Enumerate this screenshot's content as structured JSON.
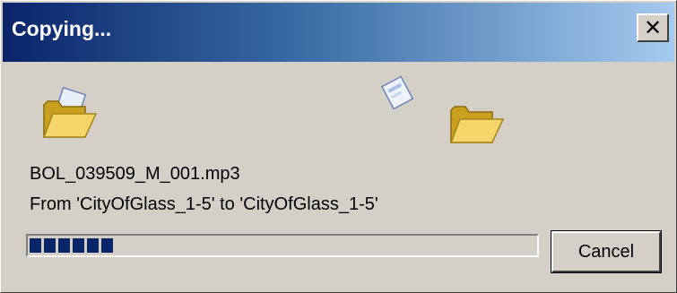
{
  "window": {
    "title": "Copying...",
    "close_symbol": "✕"
  },
  "icons": {
    "source_folder": "open-folder-icon",
    "flying_document": "flying-document-icon",
    "destination_folder": "open-folder-icon"
  },
  "operation": {
    "file_name": "BOL_039509_M_001.mp3",
    "from_to": "From 'CityOfGlass_1-5' to 'CityOfGlass_1-5'"
  },
  "progress": {
    "fraction": 0.17
  },
  "buttons": {
    "cancel_label": "Cancel"
  },
  "colors": {
    "title_gradient_start": "#0a246a",
    "title_gradient_end": "#a6caf0",
    "dialog_face": "#d4d0c8",
    "progress_block": "#0a246a"
  }
}
